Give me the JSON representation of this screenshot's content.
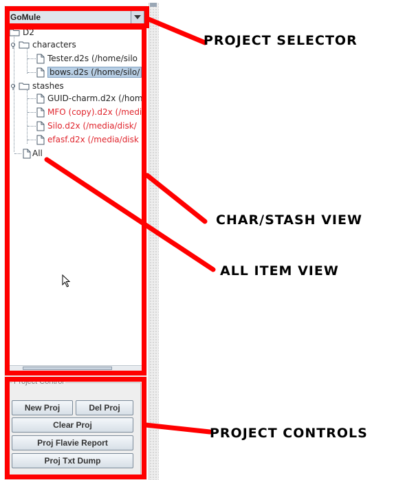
{
  "project_selector": {
    "value": "GoMule"
  },
  "tree": {
    "nodes": [
      {
        "label": "D2",
        "type": "folder"
      },
      {
        "label": "characters",
        "type": "folder"
      },
      {
        "label": "Tester.d2s (/home/silo",
        "type": "file"
      },
      {
        "label": "bows.d2s (/home/silo/",
        "type": "file",
        "selected": true
      },
      {
        "label": "stashes",
        "type": "folder"
      },
      {
        "label": "GUID-charm.d2x (/hom",
        "type": "file"
      },
      {
        "label": "MFO (copy).d2x (/medi",
        "type": "file",
        "color": "#e0242c"
      },
      {
        "label": "Silo.d2x (/media/disk/",
        "type": "file",
        "color": "#e0242c"
      },
      {
        "label": "efasf.d2x (/media/disk",
        "type": "file",
        "color": "#e0242c"
      },
      {
        "label": "All",
        "type": "file"
      }
    ]
  },
  "project_control": {
    "title": "Project Control",
    "new_label": "New Proj",
    "del_label": "Del Proj",
    "clear_label": "Clear Proj",
    "flavie_label": "Proj Flavie Report",
    "dump_label": "Proj Txt Dump"
  },
  "annotations": {
    "project_selector": "PROJECT SELECTOR",
    "char_stash_view": "CHAR/STASH VIEW",
    "all_item_view": "ALL ITEM VIEW",
    "project_controls": "PROJECT CONTROLS"
  },
  "colors": {
    "annotation": "#ff0000",
    "warning_file": "#e0242c",
    "selection": "#b8cfe5"
  }
}
